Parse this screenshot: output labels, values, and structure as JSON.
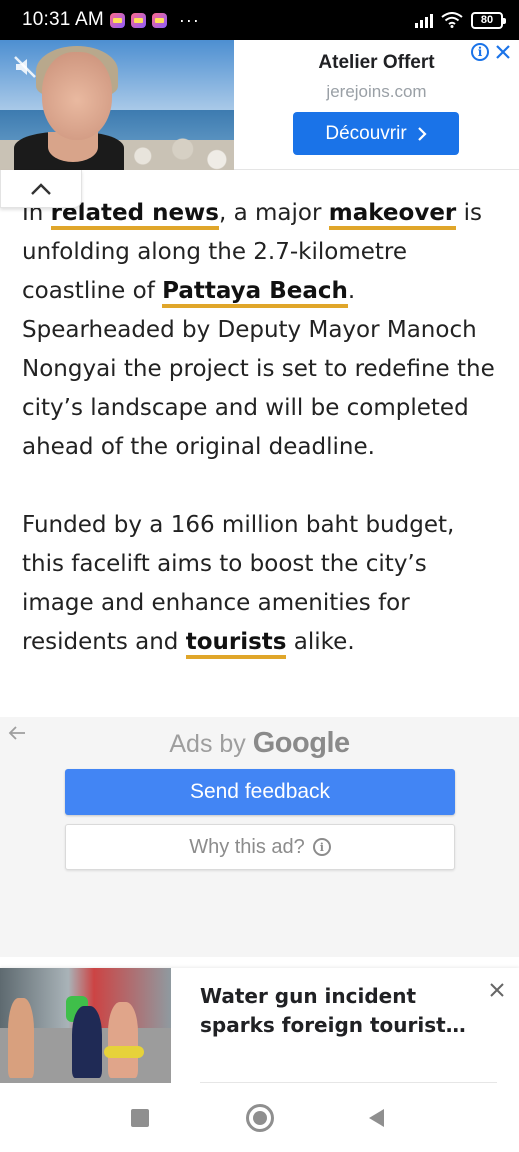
{
  "status_bar": {
    "time": "10:31 AM",
    "more": "···",
    "battery": "80"
  },
  "top_ad": {
    "title": "Atelier Offert",
    "domain": "jerejoins.com",
    "cta_label": "Découvrir",
    "adchoices": "i"
  },
  "article": {
    "p1": {
      "t1": "In ",
      "kw1": "related news",
      "t2": ", a major ",
      "kw2": "makeover",
      "t3": " is unfolding along the 2.7-kilometre coastline of ",
      "kw3": "Pattaya Beach",
      "t4": ". Spearheaded by Deputy Mayor Manoch Nongyai the project is set to redefine the city’s landscape and will be completed ahead of the original deadline."
    },
    "p2": {
      "t1": "Funded by a 166 million baht budget, this facelift aims to boost the city’s image and enhance amenities for residents and ",
      "kw1": "tourists",
      "t2": " alike."
    }
  },
  "ad_feedback": {
    "ads_by": "Ads by",
    "google": "Google",
    "send_feedback": "Send feedback",
    "why_this_ad": "Why this ad?",
    "info": "i"
  },
  "recommendation": {
    "title": "Water gun incident sparks foreign tourist…"
  },
  "colors": {
    "keyword_underline": "#e0a62a",
    "cta_blue": "#1a73e8",
    "feedback_blue": "#4285f4"
  }
}
